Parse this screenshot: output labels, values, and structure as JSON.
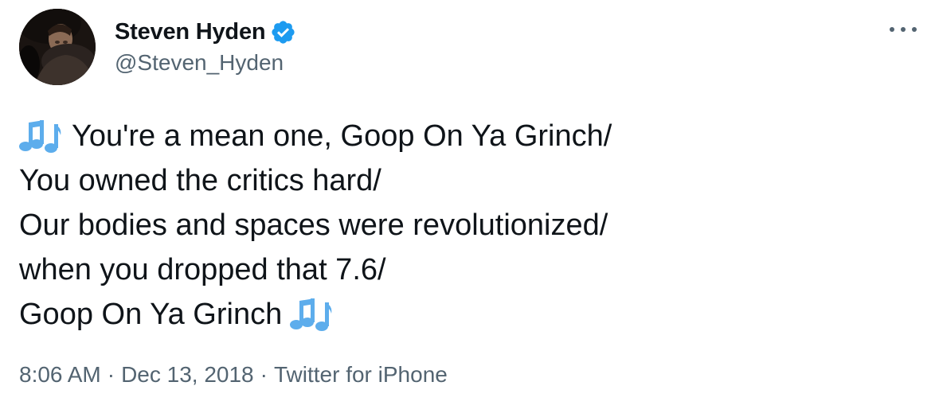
{
  "author": {
    "display_name": "Steven Hyden",
    "handle": "@Steven_Hyden",
    "verified": true
  },
  "tweet": {
    "lines": [
      "You're a mean one, Goop On Ya Grinch/",
      "You owned the critics hard/",
      "Our bodies and spaces were revolutionized/",
      "when you dropped that 7.6/",
      "Goop On Ya Grinch"
    ],
    "emoji": "musical-notes"
  },
  "meta": {
    "time": "8:06 AM",
    "date": "Dec 13, 2018",
    "separator": "·",
    "source": "Twitter for iPhone"
  },
  "colors": {
    "text": "#0f1419",
    "secondary": "#536471",
    "verified_blue": "#1d9bf0",
    "emoji_blue": "#5dadec"
  },
  "icons": [
    "avatar-photo",
    "verified-badge-icon",
    "more-options-icon",
    "musical-notes-icon"
  ]
}
